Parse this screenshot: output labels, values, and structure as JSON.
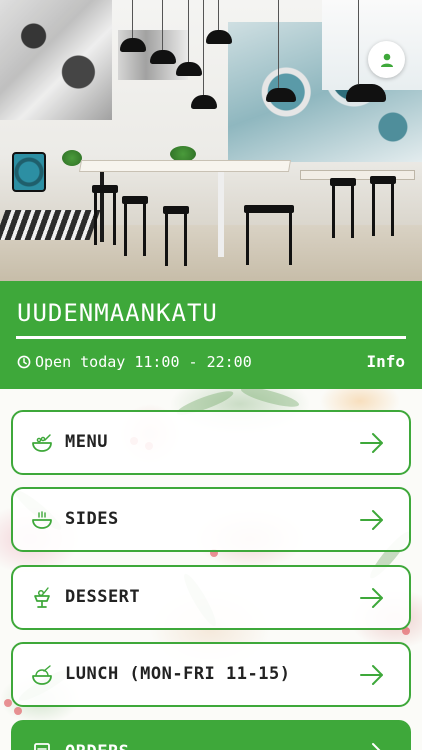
{
  "location": {
    "name": "UUDENMAANKATU",
    "hours": "Open today 11:00 - 22:00",
    "info_label": "Info"
  },
  "header": {
    "profile_icon": "user-icon"
  },
  "menu": [
    {
      "label": "MENU",
      "icon": "bowl-icon"
    },
    {
      "label": "SIDES",
      "icon": "small-bowl-icon"
    },
    {
      "label": "DESSERT",
      "icon": "dessert-icon"
    },
    {
      "label": "LUNCH (MON-FRI 11-15)",
      "icon": "rice-bowl-icon"
    },
    {
      "label": "ORDERS",
      "icon": "receipt-icon"
    }
  ],
  "colors": {
    "brand_green": "#3ea83a",
    "text_dark": "#222222",
    "white": "#ffffff"
  }
}
